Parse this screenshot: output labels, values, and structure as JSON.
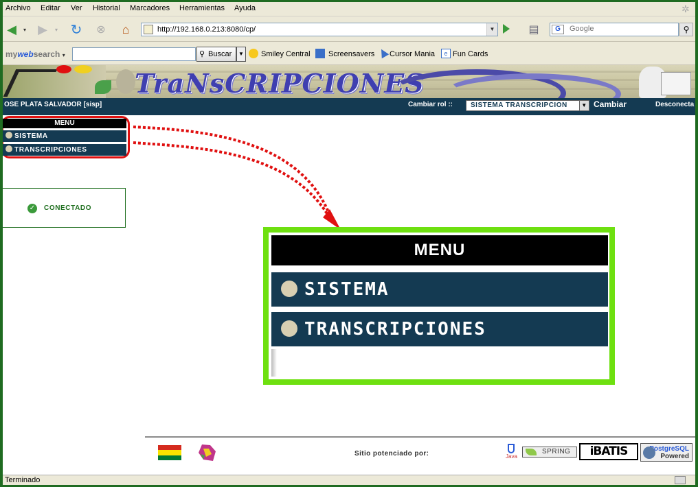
{
  "menubar": {
    "items": [
      "Archivo",
      "Editar",
      "Ver",
      "Historial",
      "Marcadores",
      "Herramientas",
      "Ayuda"
    ]
  },
  "navbar": {
    "url": "http://192.168.0.213:8080/cp/",
    "google_placeholder": "Google"
  },
  "toolbar": {
    "brand_prefix": "my",
    "brand_main": "web",
    "brand_suffix": "search",
    "buscar_label": "Buscar",
    "items": [
      "Smiley Central",
      "Screensavers",
      "Cursor Mania",
      "Fun Cards"
    ]
  },
  "banner": {
    "title": "TraNsCRIPCIONES"
  },
  "userbar": {
    "user": "OSE PLATA SALVADOR [sisp]",
    "role_label": "Cambiar rol ::",
    "role_selected": "SISTEMA TRANSCRIPCION",
    "change_label": "Cambiar",
    "logout_label": "Desconecta"
  },
  "sidebar": {
    "menu_title": "MENU",
    "items": [
      {
        "label": "SISTEMA"
      },
      {
        "label": "TRANSCRIPCIONES"
      }
    ],
    "status": "CONECTADO"
  },
  "callout": {
    "menu_title": "MENU",
    "items": [
      {
        "label": "SISTEMA"
      },
      {
        "label": "TRANSCRIPCIONES"
      }
    ]
  },
  "footer": {
    "powered_by": "Sitio potenciado por:",
    "java_label": "Java",
    "spring_label": "SPRING",
    "ibatis_label": "iBATIS",
    "postgres_label_1": "PostgreSQL",
    "postgres_label_2": "Powered"
  },
  "status": {
    "text": "Terminado"
  },
  "colors": {
    "menu_bg": "#143a52",
    "highlight": "#e01010",
    "callout_border": "#6ee010"
  }
}
